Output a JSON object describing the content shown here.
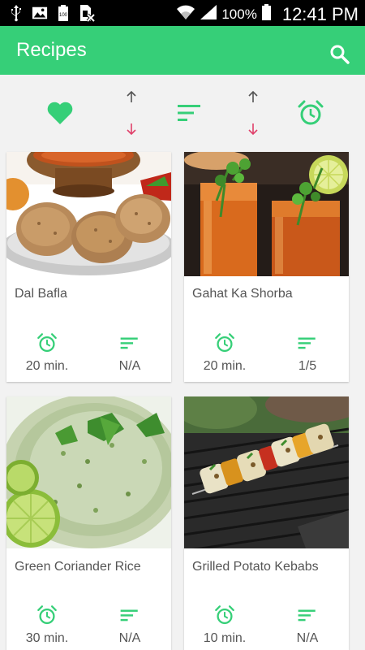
{
  "status_bar": {
    "battery_level": "100",
    "battery_percent": "100%",
    "time": "12:41 PM"
  },
  "app_bar": {
    "title": "Recipes"
  },
  "colors": {
    "accent": "#36cf78",
    "down_arrow": "#e0406a"
  },
  "recipes": [
    {
      "name": "Dal Bafla",
      "time": "20 min.",
      "difficulty": "N/A"
    },
    {
      "name": "Gahat Ka Shorba",
      "time": "20 min.",
      "difficulty": "1/5"
    },
    {
      "name": "Green Coriander Rice",
      "time": "30 min.",
      "difficulty": "N/A"
    },
    {
      "name": "Grilled Potato Kebabs",
      "time": "10 min.",
      "difficulty": "N/A"
    }
  ]
}
